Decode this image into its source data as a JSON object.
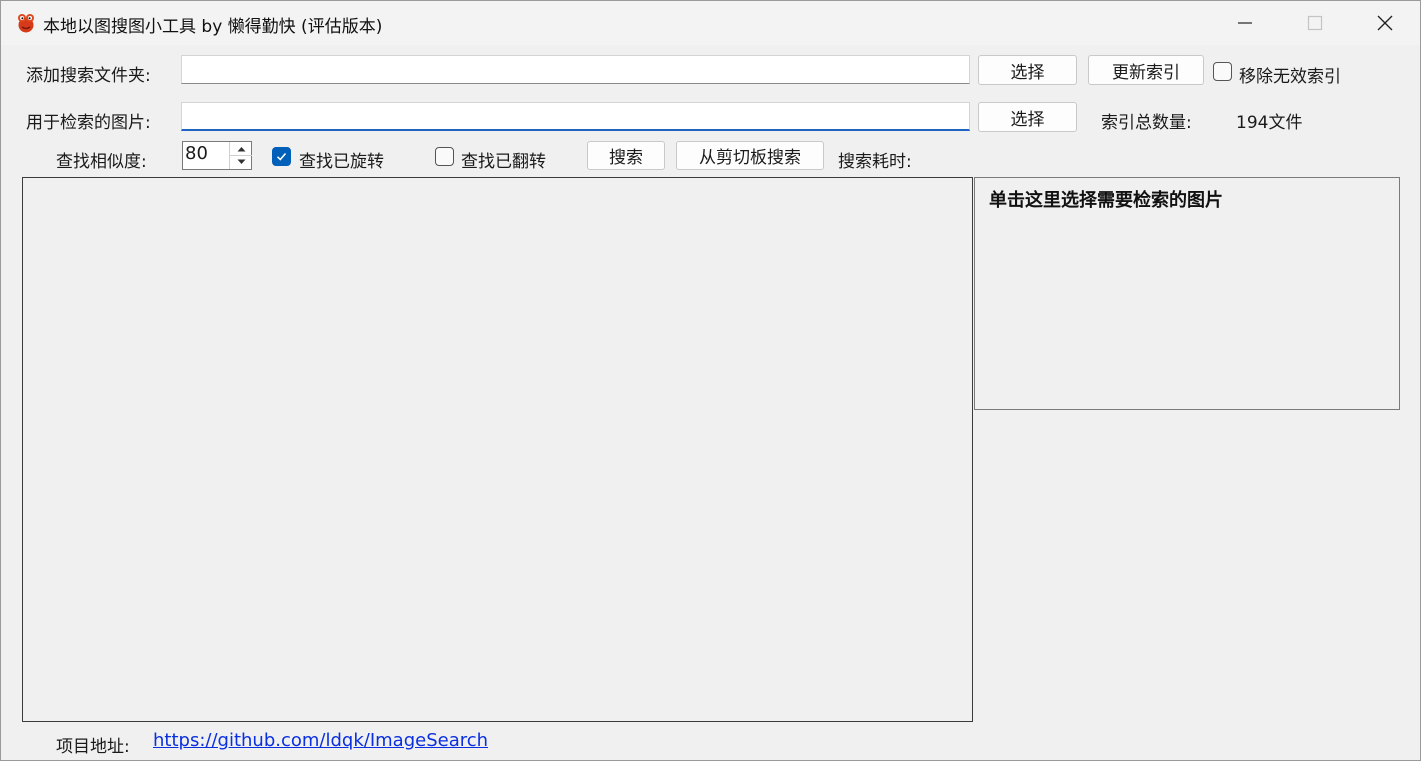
{
  "window": {
    "title": "本地以图搜图小工具 by 懒得勤快 (评估版本)",
    "icon": "red-bug-app-icon",
    "controls": {
      "minimize": "—",
      "maximize": "☐",
      "close": "✕"
    }
  },
  "folder_row": {
    "label": "添加搜索文件夹:",
    "input_value": "",
    "select_button": "选择",
    "update_index_button": "更新索引",
    "remove_invalid_label": "移除无效索引",
    "remove_invalid_checked": false
  },
  "image_row": {
    "label": "用于检索的图片:",
    "input_value": "",
    "select_button": "选择",
    "index_count_label": "索引总数量:",
    "index_count_value": "194文件"
  },
  "search_row": {
    "similarity_label": "查找相似度:",
    "similarity_value": "80",
    "find_rotated_label": "查找已旋转",
    "find_rotated_checked": true,
    "find_flipped_label": "查找已翻转",
    "find_flipped_checked": false,
    "search_button": "搜索",
    "clipboard_search_button": "从剪切板搜索",
    "elapsed_label": "搜索耗时:",
    "elapsed_value": ""
  },
  "preview": {
    "hint": "单击这里选择需要检索的图片"
  },
  "footer": {
    "project_label": "项目地址:",
    "project_link": "https://github.com/ldqk/ImageSearch"
  },
  "colors": {
    "accent": "#005fb8",
    "link": "#0a2fe0",
    "window_bg": "#f0f0f0"
  }
}
